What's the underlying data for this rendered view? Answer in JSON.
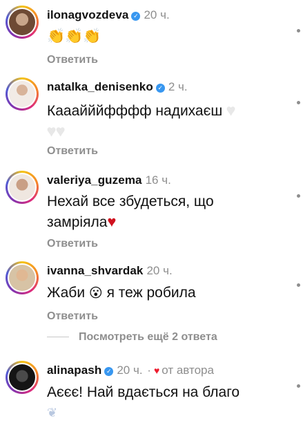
{
  "comments": [
    {
      "username": "ilonagvozdeva",
      "verified": true,
      "time": "20 ч.",
      "text": "👏👏👏",
      "reply_label": "Ответить",
      "avatar_color": "#8b6a4f"
    },
    {
      "username": "natalka_denisenko",
      "verified": true,
      "time": "2 ч.",
      "text_line1": "Кааайййфффф надихаєш",
      "reply_label": "Ответить",
      "avatar_color": "#e9dcd2"
    },
    {
      "username": "valeriya_guzema",
      "verified": false,
      "time": "16 ч.",
      "text_line1": "Нехай все збудеться, що",
      "text_line2": "замріяла",
      "reply_label": "Ответить",
      "avatar_color": "#d7c5b5"
    },
    {
      "username": "ivanna_shvardak",
      "verified": false,
      "time": "20 ч.",
      "text_before": "Жаби",
      "text_after": "я теж робила",
      "emoji": "😮",
      "reply_label": "Ответить",
      "avatar_color": "#e7d2b4"
    },
    {
      "username": "alinapash",
      "verified": true,
      "time": "20 ч.",
      "separator": "·",
      "author_label": "от автора",
      "text_line1": "Аєєє! Най вдається на благо",
      "avatar_color": "#2b2b2b"
    }
  ],
  "view_more_replies": "Посмотреть ещё 2 ответа",
  "colors": {
    "secondary_text": "#8e8e8e",
    "verified_blue": "#3897f0",
    "heart_red": "#d0111e"
  }
}
